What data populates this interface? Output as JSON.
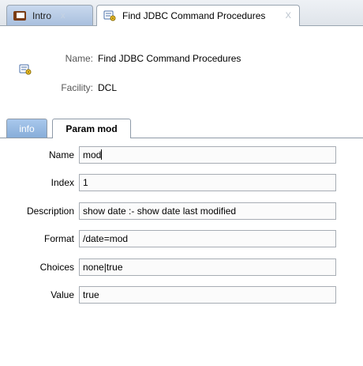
{
  "tabs": [
    {
      "label": "Intro",
      "icon": "book-icon",
      "close": "x"
    },
    {
      "label": "Find JDBC Command Procedures",
      "icon": "procedure-icon",
      "close": "X"
    }
  ],
  "header": {
    "name_label": "Name:",
    "name_value": "Find JDBC Command Procedures",
    "facility_label": "Facility:",
    "facility_value": "DCL"
  },
  "inner_tabs": [
    {
      "label": "info"
    },
    {
      "label": "Param mod"
    }
  ],
  "form": {
    "name_label": "Name",
    "name_value": "mod",
    "index_label": "Index",
    "index_value": "1",
    "description_label": "Description",
    "description_value": "show date :- show date last modified",
    "format_label": "Format",
    "format_value": "/date=mod",
    "choices_label": "Choices",
    "choices_value": "none|true",
    "value_label": "Value",
    "value_value": "true"
  },
  "colors": {
    "active_tab": "#ffffff",
    "inactive_tab": "#a9c0de",
    "info_tab": "#87add9",
    "field_border": "#a7adb4"
  }
}
